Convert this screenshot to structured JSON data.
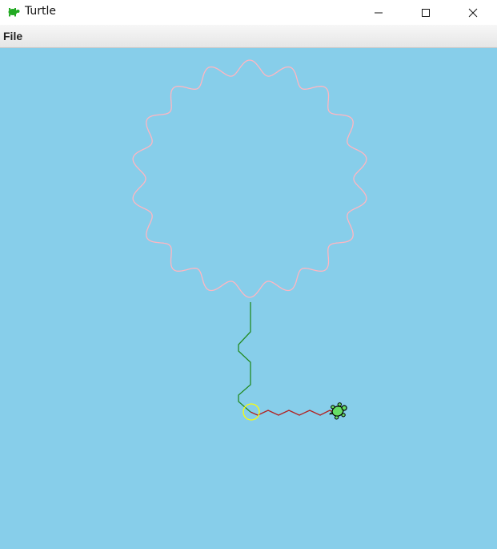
{
  "window": {
    "title": "Turtle",
    "title_icon": "turtle-icon",
    "controls": [
      "minimize-icon",
      "maximize-icon",
      "close-icon"
    ]
  },
  "menubar": {
    "items": [
      {
        "label": "File"
      }
    ]
  },
  "canvas": {
    "background": "#87CEEA",
    "drawing": {
      "flower_color": "#FFB6C1",
      "stem_color": "#228B22",
      "zigzag_color": "#B22222",
      "circle_color": "#FFFF00",
      "turtle_color": "#66DD66",
      "turtle_icon": "turtle-cursor-icon"
    }
  }
}
